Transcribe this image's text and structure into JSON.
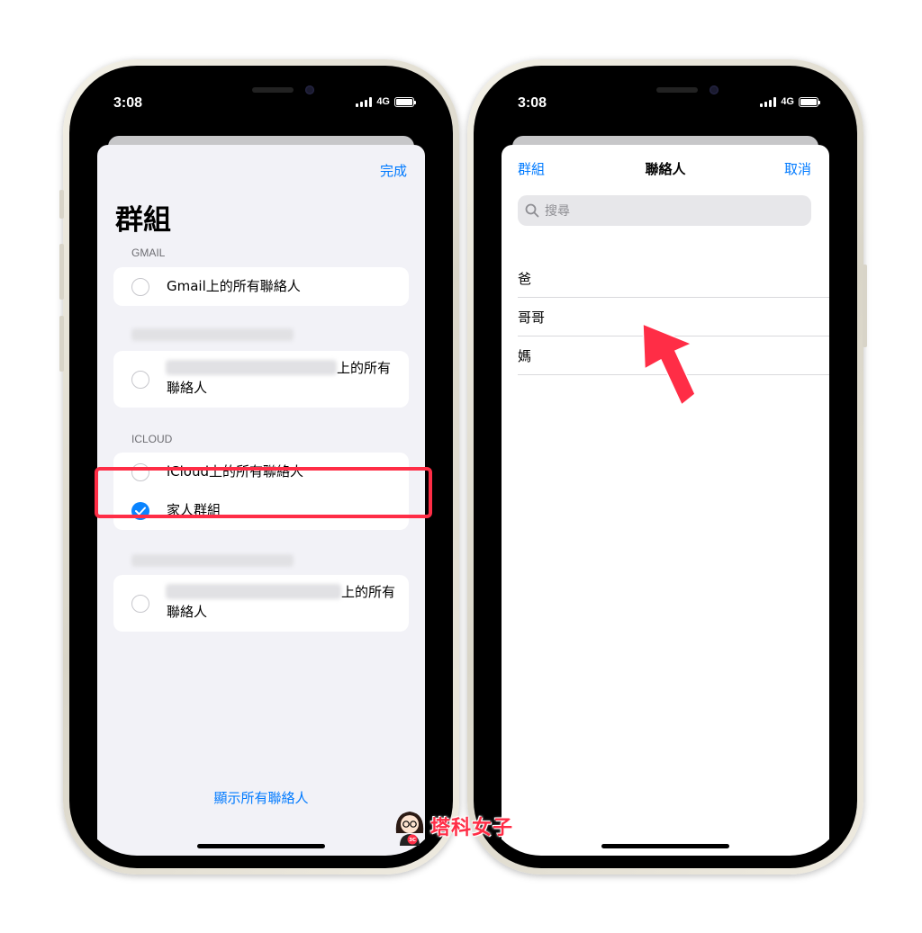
{
  "status_bar": {
    "time": "3:08",
    "network": "4G"
  },
  "left_screen": {
    "done_label": "完成",
    "title": "群組",
    "sections": [
      {
        "header": "GMAIL",
        "items": [
          {
            "label": "Gmail上的所有聯絡人",
            "checked": false
          }
        ]
      },
      {
        "header": "",
        "items": [
          {
            "label_suffix": "上的所有",
            "label_line2": "聯絡人",
            "checked": false,
            "redacted": true
          }
        ]
      },
      {
        "header": "ICLOUD",
        "items": [
          {
            "label": "iCloud上的所有聯絡人",
            "checked": false
          },
          {
            "label": "家人群組",
            "checked": true
          }
        ]
      },
      {
        "header": "",
        "items": [
          {
            "label_suffix": "上的所有",
            "label_line2": "聯絡人",
            "checked": false,
            "redacted": true
          }
        ]
      }
    ],
    "show_all_label": "顯示所有聯絡人"
  },
  "right_screen": {
    "nav": {
      "back_label": "群組",
      "title": "聯絡人",
      "cancel_label": "取消"
    },
    "search": {
      "placeholder": "搜尋"
    },
    "contacts": [
      "爸",
      "哥哥",
      "媽"
    ]
  },
  "annotations": {
    "highlight_color": "#ff2d46",
    "arrow_color": "#ff2d46"
  },
  "watermark": {
    "text": "塔科女子",
    "badge": "3C"
  }
}
